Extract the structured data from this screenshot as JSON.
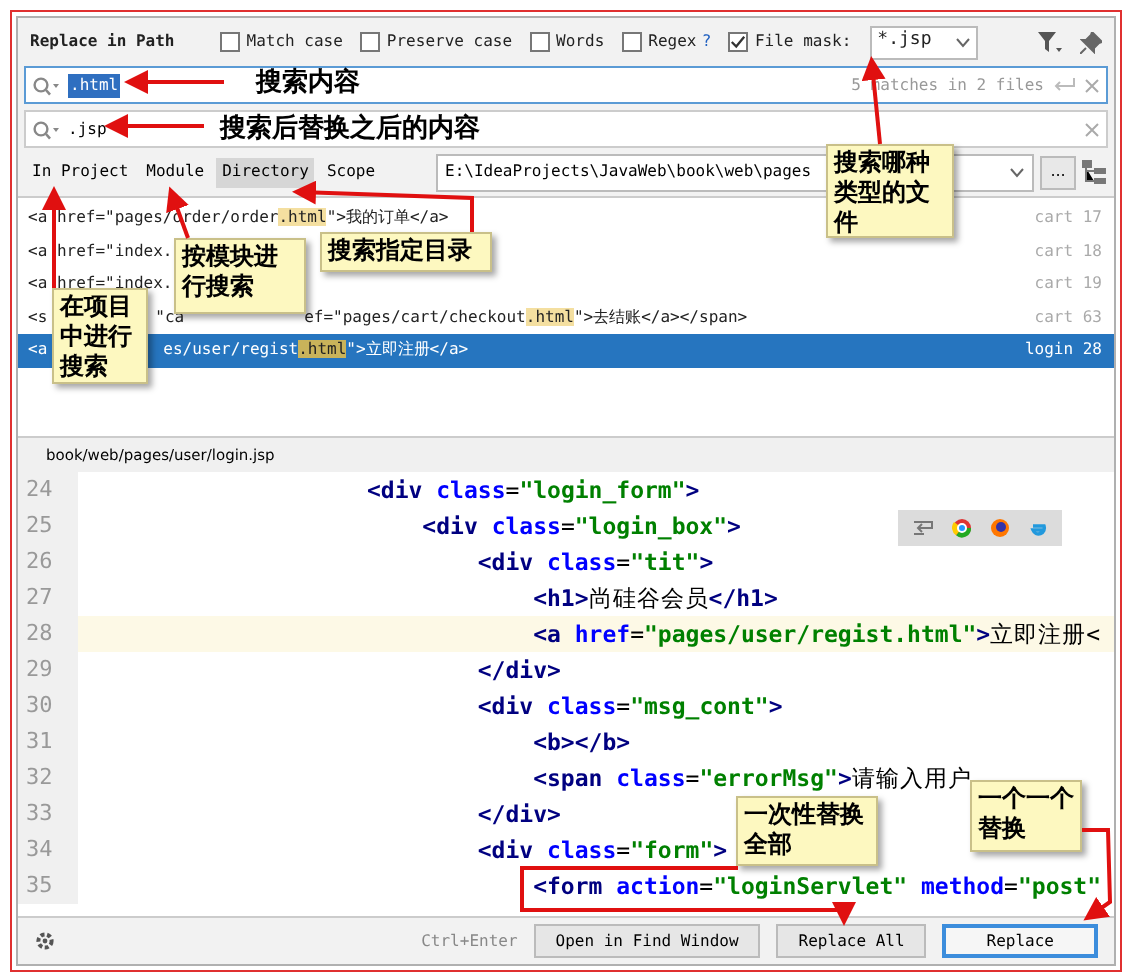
{
  "dialog": {
    "title": "Replace in Path",
    "options": [
      {
        "label": "Match case",
        "checked": false
      },
      {
        "label": "Preserve case",
        "checked": false
      },
      {
        "label": "Words",
        "checked": false
      },
      {
        "label": "Regex",
        "checked": false,
        "help": "?"
      },
      {
        "label": "File mask:",
        "checked": true
      }
    ],
    "file_mask": "*.jsp",
    "search": {
      "value": ".html",
      "matches": "5 matches in 2 files"
    },
    "replace": {
      "value": ".jsp"
    },
    "scopes": [
      {
        "label": "In Project",
        "selected": false
      },
      {
        "label": "Module",
        "selected": false
      },
      {
        "label": "Directory",
        "selected": true
      },
      {
        "label": "Scope",
        "selected": false
      }
    ],
    "directory": "E:\\IdeaProjects\\JavaWeb\\book\\web\\pages",
    "more_button": "...",
    "results": [
      {
        "runs": [
          [
            {
              "text": "<a href=\"pages/order/order",
              "match": false
            },
            {
              "text": ".html",
              "match": true
            },
            {
              "text": "\">我的订单</a>",
              "match": false
            }
          ]
        ],
        "file": "cart 17",
        "selected": false
      },
      {
        "runs": [
          [
            {
              "text": "<a href=\"index.",
              "match": false
            }
          ]
        ],
        "file": "cart 18",
        "selected": false
      },
      {
        "runs": [
          [
            {
              "text": "<a href=\"index.",
              "match": false
            }
          ]
        ],
        "file": "cart 19",
        "selected": false
      },
      {
        "runs": [
          [
            {
              "text": "<s",
              "match": false
            }
          ],
          [
            {
              "text": "\"ca",
              "match": false
            }
          ],
          [
            {
              "text": "ef=\"pages/cart/checkout",
              "match": false
            },
            {
              "text": ".html",
              "match": true
            },
            {
              "text": "\">去结账</a></span>",
              "match": false
            }
          ]
        ],
        "file": "cart 63",
        "selected": false
      },
      {
        "runs": [
          [
            {
              "text": "<a",
              "match": false
            }
          ],
          [
            {
              "text": "es/user/regist",
              "match": false
            },
            {
              "text": ".html",
              "match": true
            },
            {
              "text": "\">立即注册</a>",
              "match": false
            }
          ]
        ],
        "file": "login 28",
        "selected": true
      }
    ],
    "file_path": "book/web/pages/user/login.jsp",
    "editor_lines": [
      {
        "number": "24",
        "code": "                    <div class=\"login_form\">",
        "current": false
      },
      {
        "number": "25",
        "code": "                        <div class=\"login_box\">",
        "current": false
      },
      {
        "number": "26",
        "code": "                            <div class=\"tit\">",
        "current": false
      },
      {
        "number": "27",
        "code": "                                <h1>尚硅谷会员</h1>",
        "current": false
      },
      {
        "number": "28",
        "code": "                                <a href=\"pages/user/regist.html\">立即注册<",
        "current": true
      },
      {
        "number": "29",
        "code": "                            </div>",
        "current": false
      },
      {
        "number": "30",
        "code": "                            <div class=\"msg_cont\">",
        "current": false
      },
      {
        "number": "31",
        "code": "                                <b></b>",
        "current": false
      },
      {
        "number": "32",
        "code": "                                <span class=\"errorMsg\">请输入用户",
        "current": false
      },
      {
        "number": "33",
        "code": "                            </div>",
        "current": false
      },
      {
        "number": "34",
        "code": "                            <div class=\"form\">",
        "current": false
      },
      {
        "number": "35",
        "code": "                                <form action=\"loginServlet\" method=\"post\"",
        "current": false
      }
    ],
    "shortcut": "Ctrl+Enter",
    "buttons": [
      {
        "label": "Open in Find Window",
        "default": false
      },
      {
        "label": "Replace All",
        "default": false
      },
      {
        "label": "Replace",
        "default": true
      }
    ]
  },
  "annotations": [
    {
      "kind": "label",
      "text": "搜索内容"
    },
    {
      "kind": "label",
      "text": "搜索后替换之后的内容"
    },
    {
      "kind": "note",
      "text": "在项目中进行搜索"
    },
    {
      "kind": "note",
      "text": "按模块进行搜索"
    },
    {
      "kind": "note",
      "text": "搜索指定目录"
    },
    {
      "kind": "note",
      "text": "搜索哪种类型的文件"
    },
    {
      "kind": "note",
      "text": "一次性替换全部"
    },
    {
      "kind": "note",
      "text": "一个一个替换"
    }
  ]
}
